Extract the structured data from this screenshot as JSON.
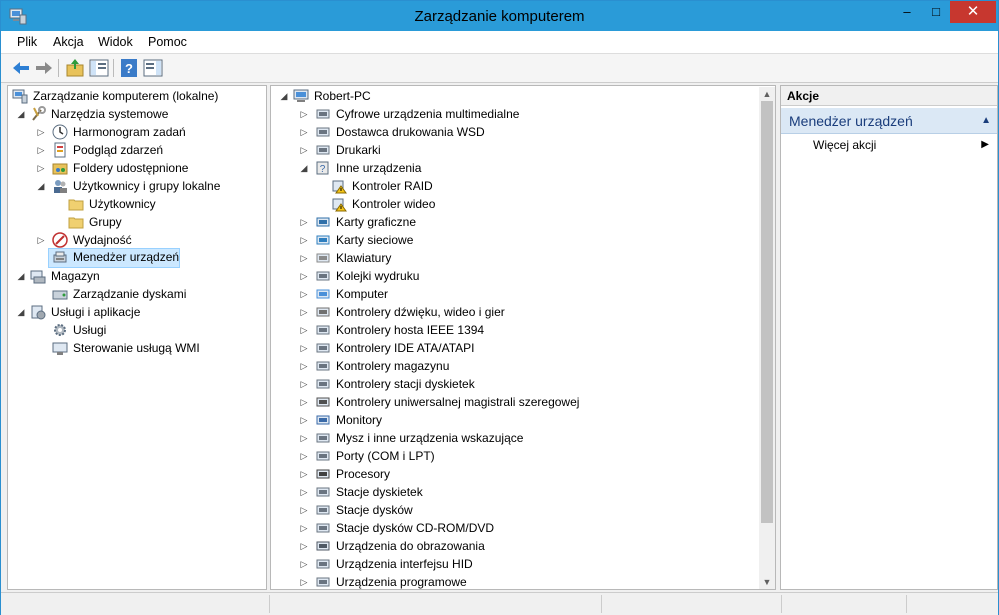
{
  "window": {
    "title": "Zarządzanie komputerem",
    "minimize_glyph": "–",
    "maximize_glyph": "□",
    "close_glyph": "✕"
  },
  "menu": [
    "Plik",
    "Akcja",
    "Widok",
    "Pomoc"
  ],
  "toolbar": [
    "back-icon",
    "forward-icon",
    "up-folder-icon",
    "show-hide-tree-icon",
    "help-icon",
    "show-hide-action-pane-icon"
  ],
  "tree": [
    {
      "label": "Zarządzanie komputerem (lokalne)",
      "icon": "computer-management-icon",
      "expander": ""
    },
    {
      "label": "Narzędzia systemowe",
      "icon": "tools-icon",
      "expander": "◢"
    },
    {
      "label": "Harmonogram zadań",
      "icon": "clock-icon",
      "expander": "▷"
    },
    {
      "label": "Podgląd zdarzeń",
      "icon": "event-viewer-icon",
      "expander": "▷"
    },
    {
      "label": "Foldery udostępnione",
      "icon": "shared-folder-icon",
      "expander": "▷"
    },
    {
      "label": "Użytkownicy i grupy lokalne",
      "icon": "users-icon",
      "expander": "◢"
    },
    {
      "label": "Użytkownicy",
      "icon": "folder-icon",
      "expander": ""
    },
    {
      "label": "Grupy",
      "icon": "folder-icon",
      "expander": ""
    },
    {
      "label": "Wydajność",
      "icon": "performance-icon",
      "expander": "▷"
    },
    {
      "label": "Menedżer urządzeń",
      "icon": "device-manager-icon",
      "expander": ""
    },
    {
      "label": "Magazyn",
      "icon": "storage-icon",
      "expander": "◢"
    },
    {
      "label": "Zarządzanie dyskami",
      "icon": "disk-management-icon",
      "expander": ""
    },
    {
      "label": "Usługi i aplikacje",
      "icon": "services-apps-icon",
      "expander": "◢"
    },
    {
      "label": "Usługi",
      "icon": "gear-icon",
      "expander": ""
    },
    {
      "label": "Sterowanie usługą WMI",
      "icon": "wmi-icon",
      "expander": ""
    }
  ],
  "devices": {
    "root": "Robert-PC",
    "items": [
      {
        "label": "Cyfrowe urządzenia multimedialne",
        "icon": "media-device-icon",
        "expander": "▷"
      },
      {
        "label": "Dostawca drukowania WSD",
        "icon": "printer-icon",
        "expander": "▷"
      },
      {
        "label": "Drukarki",
        "icon": "printer-icon",
        "expander": "▷"
      },
      {
        "label": "Inne urządzenia",
        "icon": "unknown-device-icon",
        "expander": "◢"
      },
      {
        "label": "Kontroler RAID",
        "icon": "warning-device-icon",
        "expander": ""
      },
      {
        "label": "Kontroler wideo",
        "icon": "warning-device-icon",
        "expander": ""
      },
      {
        "label": "Karty graficzne",
        "icon": "display-adapter-icon",
        "expander": "▷"
      },
      {
        "label": "Karty sieciowe",
        "icon": "network-adapter-icon",
        "expander": "▷"
      },
      {
        "label": "Klawiatury",
        "icon": "keyboard-icon",
        "expander": "▷"
      },
      {
        "label": "Kolejki wydruku",
        "icon": "printer-icon",
        "expander": "▷"
      },
      {
        "label": "Komputer",
        "icon": "computer-icon",
        "expander": "▷"
      },
      {
        "label": "Kontrolery dźwięku, wideo i gier",
        "icon": "speaker-icon",
        "expander": "▷"
      },
      {
        "label": "Kontrolery hosta IEEE 1394",
        "icon": "firewire-icon",
        "expander": "▷"
      },
      {
        "label": "Kontrolery IDE ATA/ATAPI",
        "icon": "ide-icon",
        "expander": "▷"
      },
      {
        "label": "Kontrolery magazynu",
        "icon": "storage-controller-icon",
        "expander": "▷"
      },
      {
        "label": "Kontrolery stacji dyskietek",
        "icon": "floppy-controller-icon",
        "expander": "▷"
      },
      {
        "label": "Kontrolery uniwersalnej magistrali szeregowej",
        "icon": "usb-icon",
        "expander": "▷"
      },
      {
        "label": "Monitory",
        "icon": "monitor-icon",
        "expander": "▷"
      },
      {
        "label": "Mysz i inne urządzenia wskazujące",
        "icon": "mouse-icon",
        "expander": "▷"
      },
      {
        "label": "Porty (COM i LPT)",
        "icon": "port-icon",
        "expander": "▷"
      },
      {
        "label": "Procesory",
        "icon": "processor-icon",
        "expander": "▷"
      },
      {
        "label": "Stacje dyskietek",
        "icon": "floppy-drive-icon",
        "expander": "▷"
      },
      {
        "label": "Stacje dysków",
        "icon": "disk-drive-icon",
        "expander": "▷"
      },
      {
        "label": "Stacje dysków CD-ROM/DVD",
        "icon": "cdrom-icon",
        "expander": "▷"
      },
      {
        "label": "Urządzenia do obrazowania",
        "icon": "camera-icon",
        "expander": "▷"
      },
      {
        "label": "Urządzenia interfejsu HID",
        "icon": "hid-icon",
        "expander": "▷"
      },
      {
        "label": "Urządzenia programowe",
        "icon": "software-device-icon",
        "expander": "▷"
      }
    ]
  },
  "actions": {
    "header": "Akcje",
    "section": "Menedżer urządzeń",
    "more": "Więcej akcji"
  },
  "colors": {
    "titlebar": "#2a9bd8",
    "close": "#c7372f",
    "selection": "#cce8ff"
  }
}
